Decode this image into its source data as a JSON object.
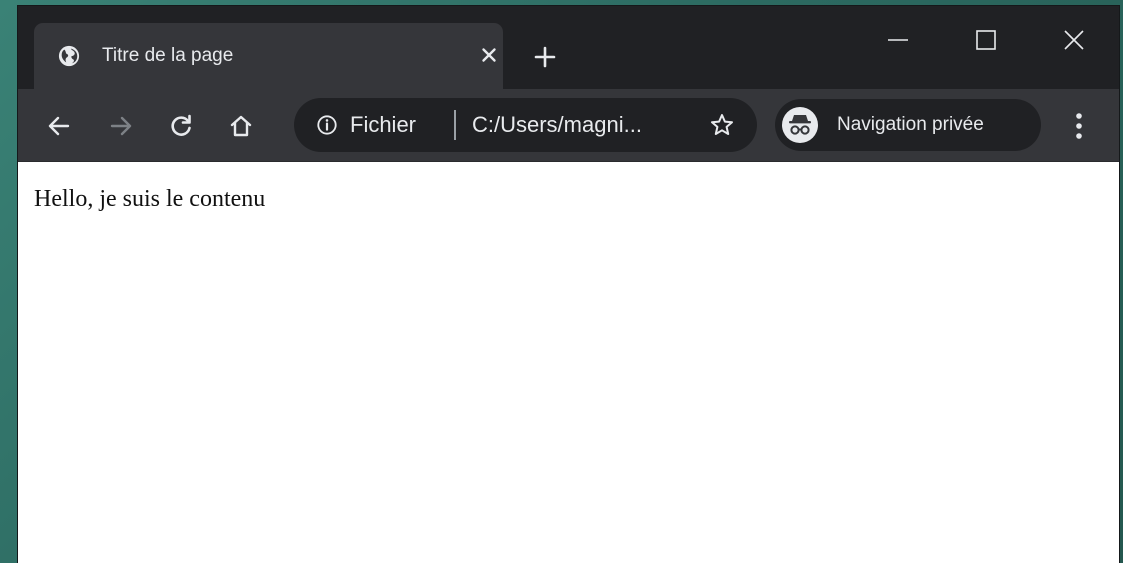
{
  "tab": {
    "title": "Titre de la page",
    "favicon": "globe-icon",
    "close_icon": "close-icon"
  },
  "new_tab_icon": "plus-icon",
  "window_controls": {
    "minimize": "minimize-icon",
    "maximize": "maximize-icon",
    "close": "close-icon"
  },
  "toolbar": {
    "back_icon": "arrow-left-icon",
    "forward_icon": "arrow-right-icon",
    "reload_icon": "reload-icon",
    "home_icon": "home-icon",
    "omnibox": {
      "info_icon": "info-icon",
      "scheme_label": "Fichier",
      "url": "C:/Users/magni...",
      "bookmark_icon": "star-icon"
    },
    "incognito": {
      "icon": "incognito-icon",
      "label": "Navigation privée"
    },
    "menu_icon": "more-vertical-icon"
  },
  "content": {
    "text": "Hello, je suis le contenu"
  },
  "colors": {
    "desktop_bg": "#2f6e66",
    "frame": "#202124",
    "tab_active": "#35363a",
    "toolbar": "#35363a",
    "text_light": "#e8eaed",
    "icon_dim": "#7d8186",
    "content_bg": "#ffffff"
  }
}
